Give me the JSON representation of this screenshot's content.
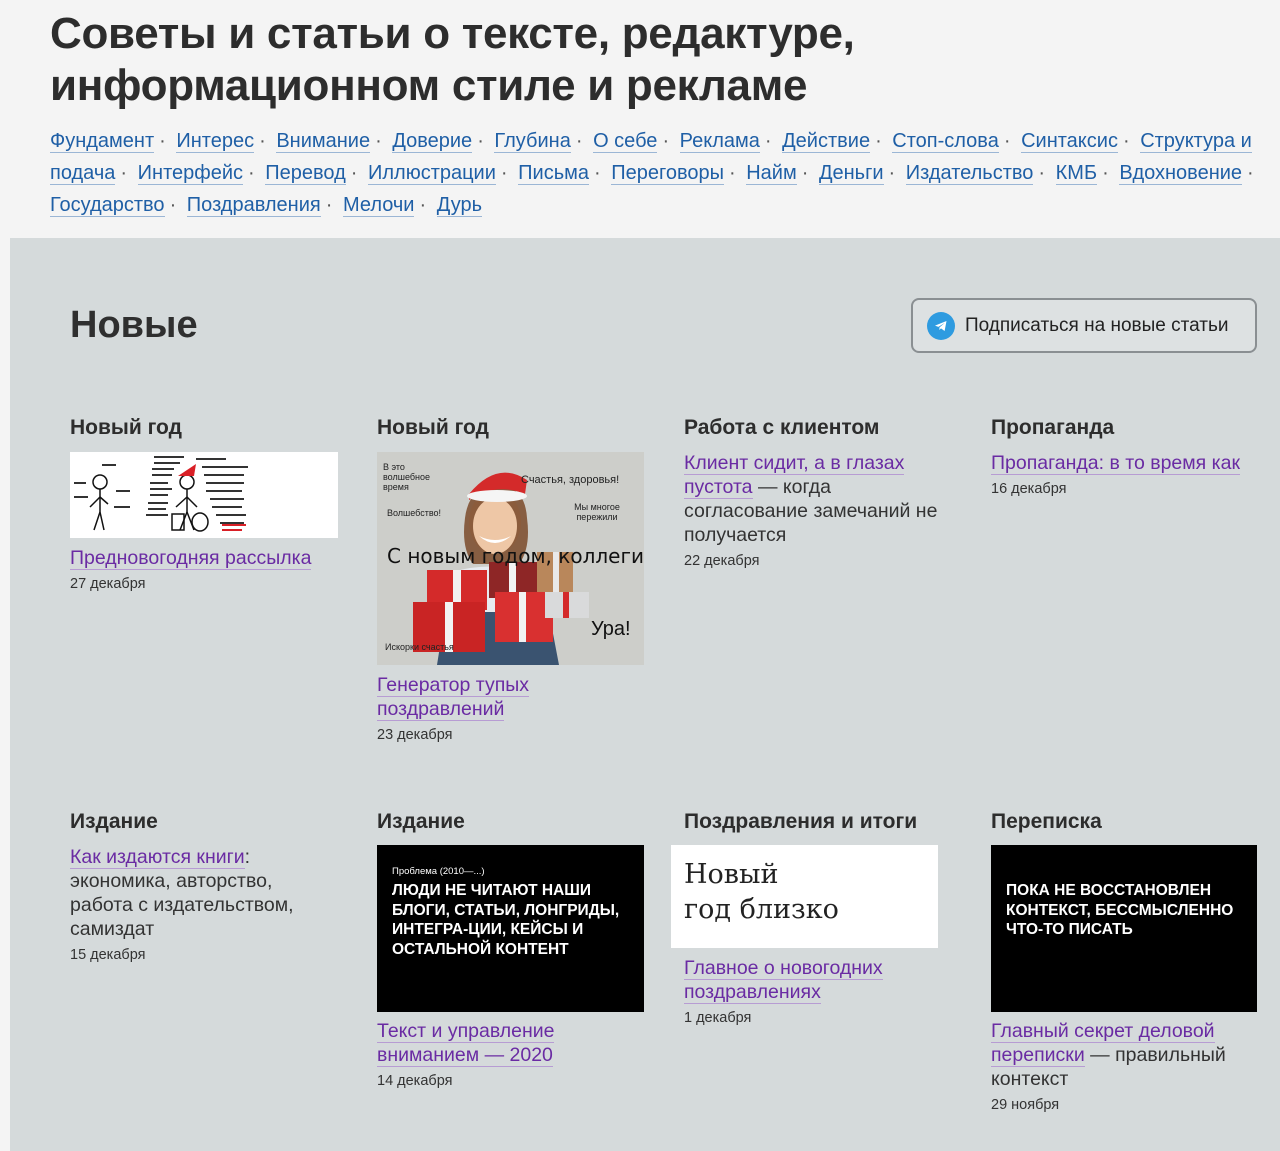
{
  "site_title_line1": "Советы и статьи о тексте, редактуре,",
  "site_title_line2": "информационном стиле и рекламе",
  "tags": [
    "Фундамент",
    "Интерес",
    "Внимание",
    "Доверие",
    "Глубина",
    "О себе",
    "Реклама",
    "Действие",
    "Стоп-слова",
    "Синтаксис",
    "Структура и подача",
    "Интерфейс",
    "Перевод",
    "Иллюстрации",
    "Письма",
    "Переговоры",
    "Найм",
    "Деньги",
    "Издательство",
    "КМБ",
    "Вдохновение",
    "Государство",
    "Поздравления",
    "Мелочи",
    "Дурь"
  ],
  "tag_separator": "·",
  "section_title": "Новые",
  "subscribe_label": "Подписаться на новые статьи",
  "cards": [
    {
      "category": "Новый год",
      "link": "Предновогодняя рассылка",
      "rest": "",
      "date": "27 декабря"
    },
    {
      "category": "Новый год",
      "link": "Генератор тупых поздравлений",
      "rest": "",
      "date": "23 декабря",
      "image_texts": {
        "t1": "В это волшебное время",
        "t2": "Счастья, здоровья!",
        "t3": "Волшебство!",
        "t4": "Мы многое пережили",
        "t5": "С новым годом, коллеги!",
        "t6": "Ура!",
        "t7": "Искорки счастья"
      }
    },
    {
      "category": "Работа с клиентом",
      "link": "Клиент сидит, а в глазах пустота",
      "rest": " — когда согласование замечаний не получается",
      "date": "22 декабря"
    },
    {
      "category": "Пропаганда",
      "link": "Пропаганда: в то время как",
      "rest": "",
      "date": "16 декабря"
    },
    {
      "category": "Издание",
      "link": "Как издаются книги",
      "rest": ": экономика, авторство, работа с издательством, самиздат",
      "date": "15 декабря"
    },
    {
      "category": "Издание",
      "link": "Текст и управление вниманием — 2020",
      "rest": "",
      "date": "14 декабря",
      "image_texts": {
        "small": "Проблема (2010—...)",
        "big": "ЛЮДИ НЕ ЧИТАЮТ НАШИ БЛОГИ, СТАТЬИ, ЛОНГРИДЫ, ИНТЕГРА-ЦИИ, КЕЙСЫ И ОСТАЛЬНОЙ КОНТЕНТ"
      }
    },
    {
      "category": "Поздравления и итоги",
      "link": "Главное о новогодних поздравлениях",
      "rest": "",
      "date": "1 декабря",
      "image_texts": {
        "line1": "Новый",
        "line2": "год близко"
      }
    },
    {
      "category": "Переписка",
      "link": "Главный секрет деловой переписки",
      "rest": " — правильный контекст",
      "date": "29 ноября",
      "image_texts": {
        "big": "ПОКА НЕ ВОССТАНОВЛЕН КОНТЕКСТ, БЕССМЫСЛЕННО ЧТО-ТО ПИСАТЬ"
      }
    }
  ],
  "colors": {
    "page_bg": "#f4f4f4",
    "panel_bg": "#d5dadb",
    "tag_link": "#1f5fa6",
    "article_link": "#6a2ba3",
    "telegram": "#2e9be0"
  }
}
